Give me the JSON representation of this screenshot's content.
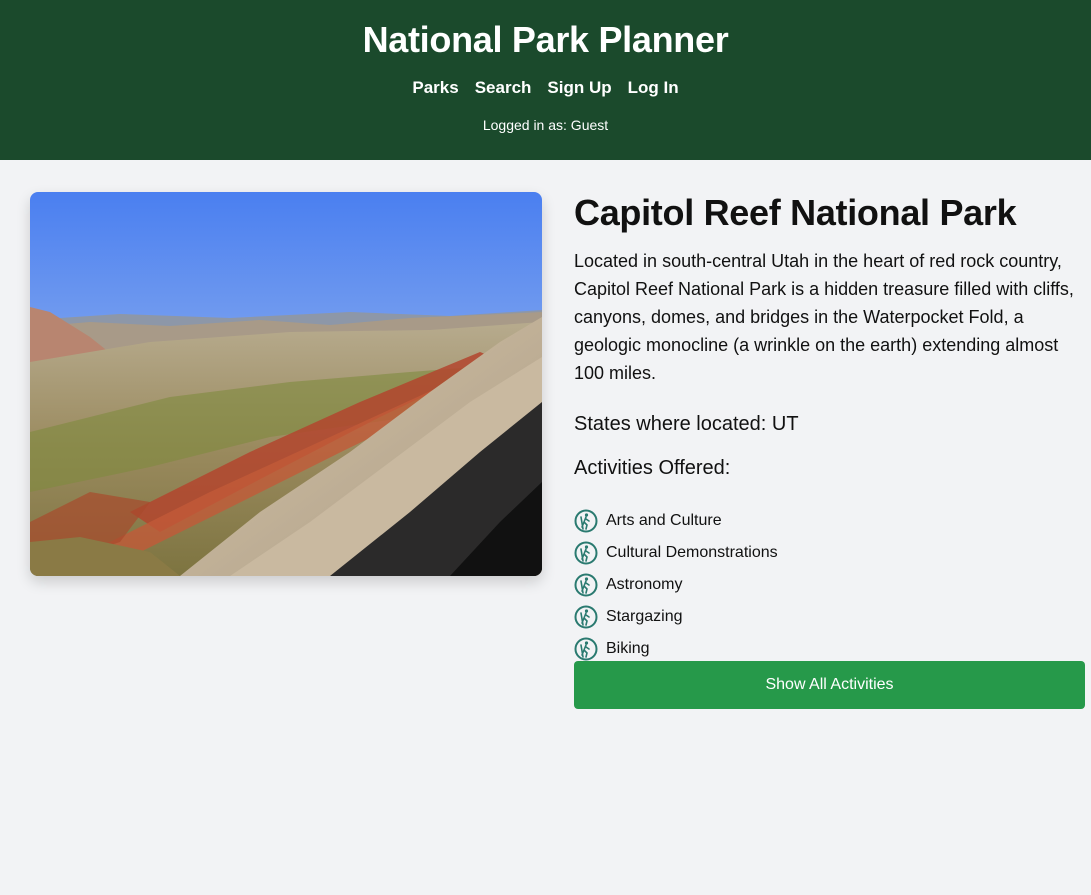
{
  "header": {
    "title": "National Park Planner",
    "nav": [
      "Parks",
      "Search",
      "Sign Up",
      "Log In"
    ],
    "status": "Logged in as: Guest"
  },
  "park": {
    "name": "Capitol Reef National Park",
    "description": "Located in south-central Utah in the heart of red rock country, Capitol Reef National Park is a hidden treasure filled with cliffs, canyons, domes, and bridges in the Waterpocket Fold, a geologic monocline (a wrinkle on the earth) extending almost 100 miles.",
    "states": "States where located: UT",
    "activities_heading": "Activities Offered:",
    "activities": [
      "Arts and Culture",
      "Cultural Demonstrations",
      "Astronomy",
      "Stargazing",
      "Biking"
    ],
    "show_all_label": "Show All Activities"
  },
  "colors": {
    "header_bg": "#1b4a2c",
    "button_bg": "#26994a",
    "icon": "#2a7a70"
  },
  "icons": {
    "activity": "hiker-icon"
  }
}
